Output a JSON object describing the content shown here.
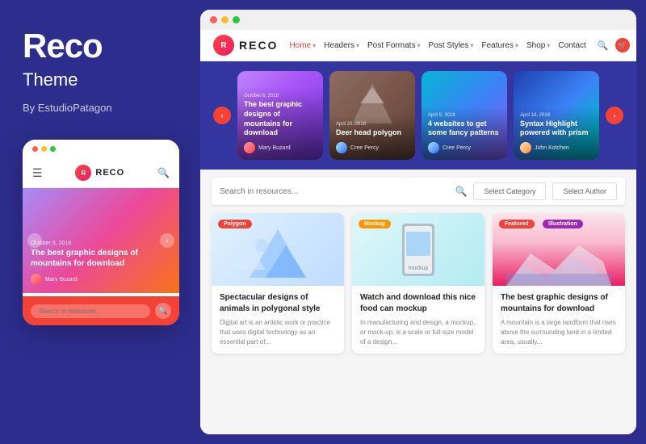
{
  "brand": {
    "title": "Reco",
    "subtitle": "Theme",
    "by": "By EstudioPatagon"
  },
  "nav": {
    "logo_letter": "R",
    "logo_text": "RECO",
    "links": [
      {
        "label": "Home",
        "active": true,
        "has_dropdown": true
      },
      {
        "label": "Headers",
        "active": false,
        "has_dropdown": true
      },
      {
        "label": "Post Formats",
        "active": false,
        "has_dropdown": true
      },
      {
        "label": "Post Styles",
        "active": false,
        "has_dropdown": true
      },
      {
        "label": "Features",
        "active": false,
        "has_dropdown": true
      },
      {
        "label": "Shop",
        "active": false,
        "has_dropdown": true
      },
      {
        "label": "Contact",
        "active": false,
        "has_dropdown": false
      }
    ]
  },
  "slider": {
    "prev_label": "‹",
    "next_label": "›",
    "cards": [
      {
        "date": "October 6, 2018",
        "title": "The best graphic designs of mountains for download",
        "author": "Mary Buzard",
        "bg": "purple"
      },
      {
        "date": "April 20, 2018",
        "title": "Deer head polygon",
        "author": "Cree Percy",
        "bg": "brown"
      },
      {
        "date": "April 9, 2018",
        "title": "4 websites to get some fancy patterns",
        "author": "Cree Percy",
        "bg": "blue"
      },
      {
        "date": "April 18, 2018",
        "title": "Syntax Highlight powered with prism",
        "author": "John Kotchen",
        "bg": "darkblue"
      }
    ]
  },
  "search": {
    "placeholder": "Search in resources...",
    "category_placeholder": "Select Category",
    "author_placeholder": "Select Author"
  },
  "articles": [
    {
      "badge": "Polygon",
      "badge_type": "polygon",
      "title": "Spectacular designs of animals in polygonal style",
      "text": "Digital art is an artistic work or practice that uses digital technology as an essential part of..."
    },
    {
      "badge": "Mockup",
      "badge_type": "mockup",
      "title": "Watch and download this nice food can mockup",
      "text": "In manufacturing and design, a mockup, or mock-up, is a scale or full-size model of a design..."
    },
    {
      "badge": "Featured",
      "badge_type": "featured",
      "badge2": "Illustration",
      "badge2_type": "illustration",
      "title": "The best graphic designs of mountains for download",
      "text": "A mountain is a large landform that rises above the surrounding land in a limited area, usually..."
    }
  ],
  "mobile": {
    "logo_letter": "R",
    "logo_text": "RECO",
    "hero_date": "October 6, 2018",
    "hero_title": "The best graphic designs of mountains for download",
    "hero_author": "Mary Buzard",
    "search_placeholder": "Search in resources..."
  },
  "dots": {
    "red": "#ff5f57",
    "yellow": "#ffbd2e",
    "green": "#28c941"
  }
}
